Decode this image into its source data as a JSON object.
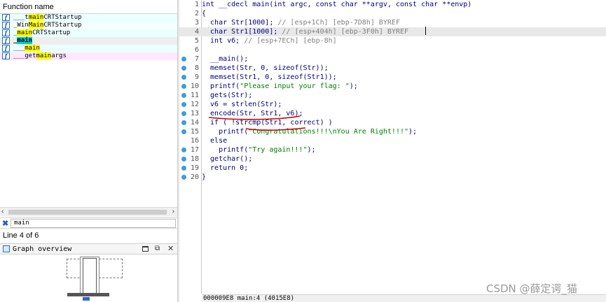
{
  "functions_panel": {
    "header": "Function name",
    "items": [
      {
        "icon": "function-icon",
        "prefix": "___t",
        "match": "main",
        "suffix": "CRTStartup"
      },
      {
        "icon": "function-icon",
        "prefix": "_Win",
        "match": "Main",
        "suffix": "CRTStartup"
      },
      {
        "icon": "function-icon",
        "prefix": "_",
        "match": "main",
        "suffix": "CRTStartup"
      },
      {
        "icon": "function-icon",
        "prefix": "_",
        "match": "main",
        "suffix": "",
        "selected": true
      },
      {
        "icon": "function-icon",
        "prefix": "___",
        "match": "main",
        "suffix": ""
      },
      {
        "icon": "function-icon",
        "prefix": "___get",
        "match": "main",
        "suffix": "args"
      }
    ],
    "search_value": "main",
    "line_status": "Line 4 of 6"
  },
  "graph_overview": {
    "title": "Graph overview"
  },
  "code": {
    "lines": [
      {
        "num": "1",
        "dot": false,
        "text": "int __cdecl main(int argc, const char **argv, const char **envp)"
      },
      {
        "num": "2",
        "dot": false,
        "text": "{"
      },
      {
        "num": "3",
        "dot": false,
        "code": "  char Str[1000]; ",
        "comment": "// [esp+1Ch] [ebp-7D8h] BYREF"
      },
      {
        "num": "4",
        "dot": false,
        "code": "  char Str1[1000]; ",
        "comment": "// [esp+404h] [ebp-3F0h] BYREF",
        "current": true
      },
      {
        "num": "5",
        "dot": false,
        "code": "  int v6; ",
        "comment": "// [esp+7ECh] [ebp-8h]"
      },
      {
        "num": "6",
        "dot": false,
        "text": ""
      },
      {
        "num": "7",
        "dot": true,
        "text": "  __main();"
      },
      {
        "num": "8",
        "dot": true,
        "text": "  memset(Str, 0, sizeof(Str));"
      },
      {
        "num": "9",
        "dot": true,
        "text": "  memset(Str1, 0, sizeof(Str1));"
      },
      {
        "num": "10",
        "dot": true,
        "text": "  printf(\"Please input your flag: \");"
      },
      {
        "num": "11",
        "dot": true,
        "text": "  gets(Str);"
      },
      {
        "num": "12",
        "dot": true,
        "text": "  v6 = strlen(Str);"
      },
      {
        "num": "13",
        "dot": true,
        "text": "  encode(Str, Str1, v6);"
      },
      {
        "num": "14",
        "dot": true,
        "text": "  if ( !strcmp(Str1, correct) )"
      },
      {
        "num": "15",
        "dot": true,
        "text": "    printf(\"Congratulations!!!\\nYou Are Right!!!\");"
      },
      {
        "num": "16",
        "dot": false,
        "text": "  else"
      },
      {
        "num": "17",
        "dot": true,
        "text": "    printf(\"Try again!!!\");"
      },
      {
        "num": "18",
        "dot": true,
        "text": "  getchar();"
      },
      {
        "num": "19",
        "dot": true,
        "text": "  return 0;"
      },
      {
        "num": "20",
        "dot": true,
        "text": "}"
      }
    ]
  },
  "status_bar": "000009E8 main:4 (4015E8)",
  "watermark": "CSDN @薛定谔_猫",
  "colors": {
    "keyword": "#000080",
    "comment": "#808080",
    "string": "#008000",
    "match_highlight": "#ffff00",
    "selected_highlight": "#00c8d0",
    "breakpoint_dot": "#3f9ae0",
    "annotation_red": "#cc0000"
  }
}
